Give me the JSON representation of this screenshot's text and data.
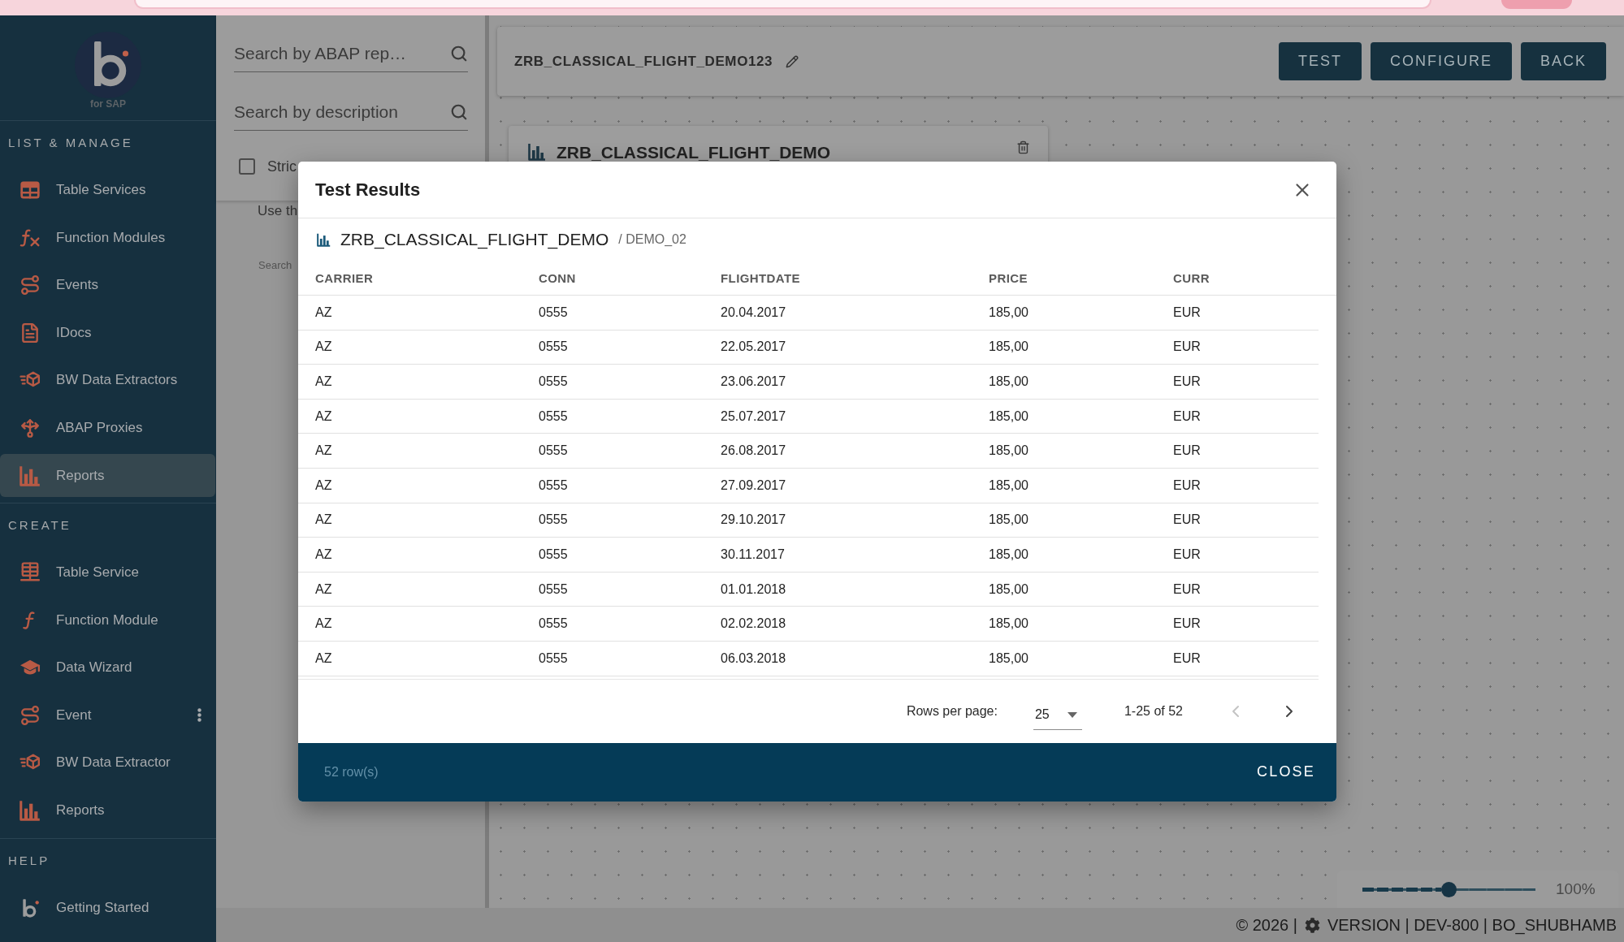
{
  "sidebar": {
    "logo_caption": "for SAP",
    "sections": [
      {
        "heading": "LIST & MANAGE",
        "items": [
          {
            "label": "Table Services",
            "selected": false,
            "hovered": false
          },
          {
            "label": "Function Modules",
            "selected": false,
            "hovered": false
          },
          {
            "label": "Events",
            "selected": false,
            "hovered": false
          },
          {
            "label": "IDocs",
            "selected": false,
            "hovered": false
          },
          {
            "label": "BW Data Extractors",
            "selected": false,
            "hovered": false
          },
          {
            "label": "ABAP Proxies",
            "selected": false,
            "hovered": false
          },
          {
            "label": "Reports",
            "selected": true,
            "hovered": false
          }
        ]
      },
      {
        "heading": "CREATE",
        "items": [
          {
            "label": "Table Service",
            "selected": false,
            "hovered": false
          },
          {
            "label": "Function Module",
            "selected": false,
            "hovered": false
          },
          {
            "label": "Data Wizard",
            "selected": false,
            "hovered": false
          },
          {
            "label": "Event",
            "selected": false,
            "hovered": true
          },
          {
            "label": "BW Data Extractor",
            "selected": false,
            "hovered": false
          },
          {
            "label": "Reports",
            "selected": false,
            "hovered": false
          }
        ]
      },
      {
        "heading": "HELP",
        "items": [
          {
            "label": "Getting Started",
            "selected": false,
            "hovered": false
          }
        ]
      }
    ]
  },
  "search_panel": {
    "fields": [
      {
        "placeholder": "Search by ABAP rep…"
      },
      {
        "placeholder": "Search by description"
      }
    ],
    "checkbox": {
      "label": "Stric",
      "checked": false
    },
    "hint": "Use th",
    "caption": "Search"
  },
  "editor": {
    "title": "ZRB_CLASSICAL_FLIGHT_DEMO123",
    "buttons": [
      "TEST",
      "CONFIGURE",
      "BACK"
    ],
    "node": {
      "title": "ZRB_CLASSICAL_FLIGHT_DEMO"
    },
    "zoom": {
      "level": 0.5,
      "reading": "100%"
    }
  },
  "dialog": {
    "title": "Test Results",
    "source": "ZRB_CLASSICAL_FLIGHT_DEMO",
    "variant": "/ DEMO_02",
    "table": {
      "columns": [
        "CARRIER",
        "CONN",
        "FLIGHTDATE",
        "PRICE",
        "CURR"
      ],
      "rows": [
        [
          "AZ",
          "0555",
          "20.04.2017",
          "185,00",
          "EUR"
        ],
        [
          "AZ",
          "0555",
          "22.05.2017",
          "185,00",
          "EUR"
        ],
        [
          "AZ",
          "0555",
          "23.06.2017",
          "185,00",
          "EUR"
        ],
        [
          "AZ",
          "0555",
          "25.07.2017",
          "185,00",
          "EUR"
        ],
        [
          "AZ",
          "0555",
          "26.08.2017",
          "185,00",
          "EUR"
        ],
        [
          "AZ",
          "0555",
          "27.09.2017",
          "185,00",
          "EUR"
        ],
        [
          "AZ",
          "0555",
          "29.10.2017",
          "185,00",
          "EUR"
        ],
        [
          "AZ",
          "0555",
          "30.11.2017",
          "185,00",
          "EUR"
        ],
        [
          "AZ",
          "0555",
          "01.01.2018",
          "185,00",
          "EUR"
        ],
        [
          "AZ",
          "0555",
          "02.02.2018",
          "185,00",
          "EUR"
        ],
        [
          "AZ",
          "0555",
          "06.03.2018",
          "185,00",
          "EUR"
        ]
      ]
    },
    "pagination": {
      "label": "Rows per page:",
      "rows_per_page": "25",
      "range": "1-25 of 52",
      "previous_disabled": true,
      "next_disabled": false
    },
    "row_count": "52 row(s)",
    "close_button": "CLOSE"
  },
  "footer": {
    "copyright": "© 2026 |",
    "details": "VERSION | DEV-800 | BO_SHUBHAMB"
  }
}
